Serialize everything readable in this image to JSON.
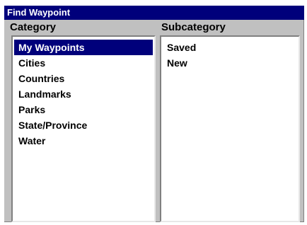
{
  "window": {
    "title": "Find Waypoint"
  },
  "category": {
    "label": "Category",
    "items": [
      {
        "label": "My Waypoints",
        "selected": true
      },
      {
        "label": "Cities"
      },
      {
        "label": "Countries"
      },
      {
        "label": "Landmarks"
      },
      {
        "label": "Parks"
      },
      {
        "label": "State/Province"
      },
      {
        "label": "Water"
      }
    ]
  },
  "subcategory": {
    "label": "Subcategory",
    "items": [
      {
        "label": "Saved"
      },
      {
        "label": "New"
      }
    ]
  },
  "colors": {
    "title_bar": "#00007b",
    "selection": "#00007b",
    "dialog_background": "#c0c0c0",
    "list_background": "#ffffff"
  }
}
